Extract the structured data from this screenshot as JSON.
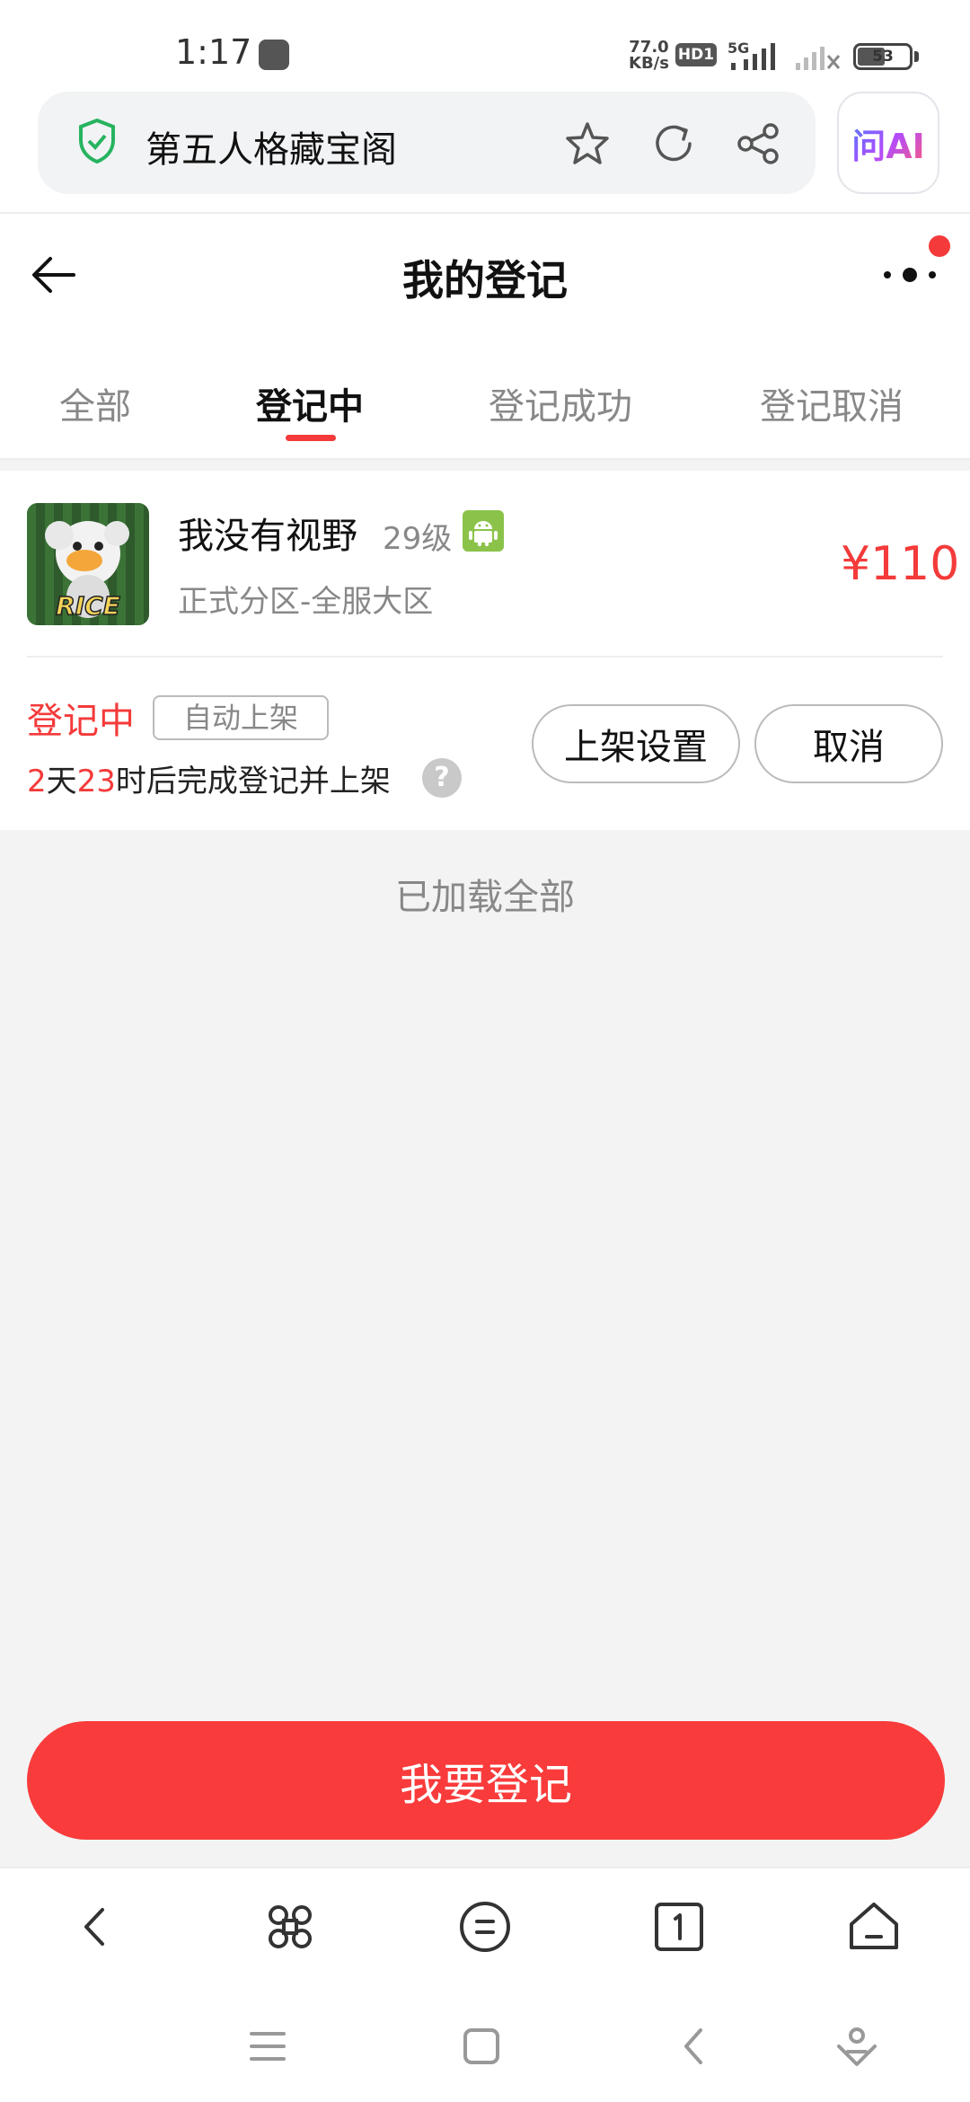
{
  "status_bar": {
    "time": "1:17",
    "net_speed_value": "77.0",
    "net_speed_unit": "KB/s",
    "hd_label": "HD1",
    "network_type": "5G",
    "battery": "53"
  },
  "browser": {
    "title": "第五人格藏宝阁",
    "ai_label": "问AI"
  },
  "header": {
    "title": "我的登记"
  },
  "tabs": [
    {
      "label": "全部",
      "active": false
    },
    {
      "label": "登记中",
      "active": true
    },
    {
      "label": "登记成功",
      "active": false
    },
    {
      "label": "登记取消",
      "active": false
    }
  ],
  "listing": {
    "name": "我没有视野",
    "level": "29级",
    "server": "正式分区-全服大区",
    "price": "¥110",
    "status": "登记中",
    "tag": "自动上架",
    "countdown_days": "2",
    "countdown_day_unit": "天",
    "countdown_hours": "23",
    "countdown_suffix": "时后完成登记并上架",
    "help_symbol": "?",
    "shelf_button": "上架设置",
    "cancel_button": "取消"
  },
  "footer_note": "已加载全部",
  "register_button": "我要登记",
  "colors": {
    "accent": "#f43a3a",
    "button": "#f93b3b",
    "background": "#f3f3f4",
    "android_green": "#8bc34a"
  },
  "icons": {
    "avatar_text": "RICE"
  }
}
